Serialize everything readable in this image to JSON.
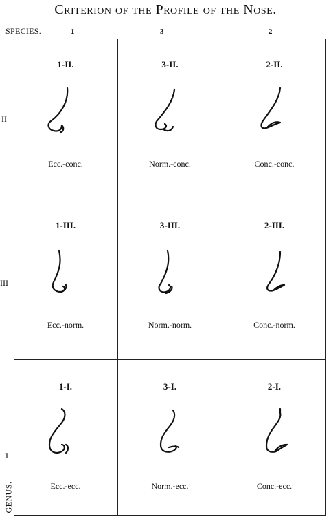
{
  "title": "Criterion of the Profile of the Nose.",
  "species_label": "SPECIES.",
  "genus_label": "GENUS.",
  "col_numbers": [
    "1",
    "3",
    "2"
  ],
  "row_numbers": [
    "II",
    "III",
    "I"
  ],
  "cells": [
    {
      "code": "1-II.",
      "name": "Ecc.-conc.",
      "icon": "nose-profile-eccentric-concave-icon"
    },
    {
      "code": "3-II.",
      "name": "Norm.-conc.",
      "icon": "nose-profile-normal-concave-icon"
    },
    {
      "code": "2-II.",
      "name": "Conc.-conc.",
      "icon": "nose-profile-concentric-concave-icon"
    },
    {
      "code": "1-III.",
      "name": "Ecc.-norm.",
      "icon": "nose-profile-eccentric-normal-icon"
    },
    {
      "code": "3-III.",
      "name": "Norm.-norm.",
      "icon": "nose-profile-normal-normal-icon"
    },
    {
      "code": "2-III.",
      "name": "Conc.-norm.",
      "icon": "nose-profile-concentric-normal-icon"
    },
    {
      "code": "1-I.",
      "name": "Ecc.-ecc.",
      "icon": "nose-profile-eccentric-eccentric-icon"
    },
    {
      "code": "3-I.",
      "name": "Norm.-ecc.",
      "icon": "nose-profile-normal-eccentric-icon"
    },
    {
      "code": "2-I.",
      "name": "Conc.-ecc.",
      "icon": "nose-profile-concentric-eccentric-icon"
    }
  ]
}
